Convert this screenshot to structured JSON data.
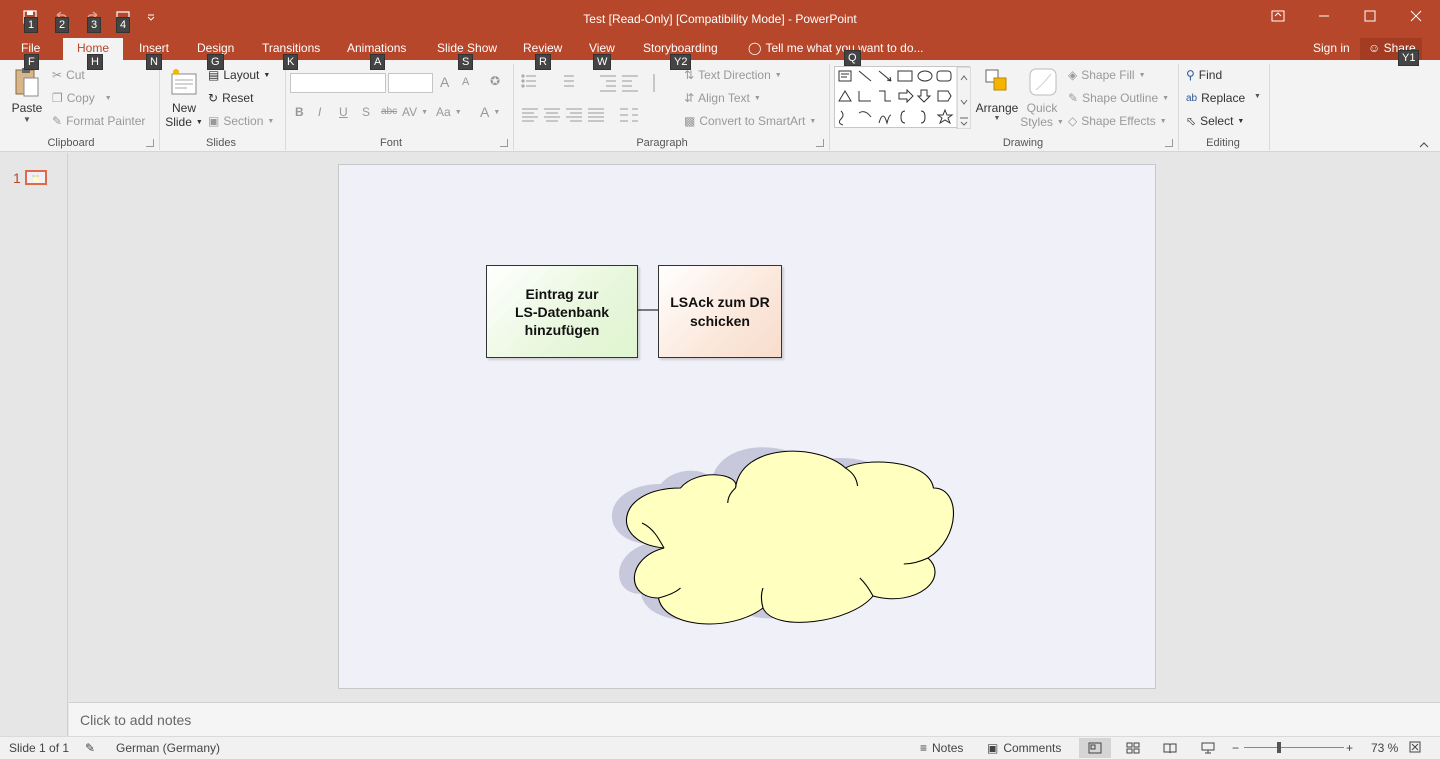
{
  "window": {
    "title": "Test [Read-Only] [Compatibility Mode] - PowerPoint",
    "sign_in": "Sign in",
    "share": "Share",
    "share_keytip": "Y1"
  },
  "qat_keytips": [
    "1",
    "2",
    "3",
    "4"
  ],
  "tabs": [
    {
      "label": "File",
      "keytip": "F"
    },
    {
      "label": "Home",
      "keytip": "H"
    },
    {
      "label": "Insert",
      "keytip": "N"
    },
    {
      "label": "Design",
      "keytip": "G"
    },
    {
      "label": "Transitions",
      "keytip": "K"
    },
    {
      "label": "Animations",
      "keytip": "A"
    },
    {
      "label": "Slide Show",
      "keytip": "S"
    },
    {
      "label": "Review",
      "keytip": "R"
    },
    {
      "label": "View",
      "keytip": "W"
    },
    {
      "label": "Storyboarding",
      "keytip": "Y2"
    }
  ],
  "tell_me": {
    "placeholder": "Tell me what you want to do...",
    "keytip": "Q"
  },
  "ribbon": {
    "clipboard": {
      "label": "Clipboard",
      "paste": "Paste",
      "cut": "Cut",
      "copy": "Copy",
      "format_painter": "Format Painter"
    },
    "slides": {
      "label": "Slides",
      "new_slide_1": "New",
      "new_slide_2": "Slide",
      "layout": "Layout",
      "reset": "Reset",
      "section": "Section"
    },
    "font": {
      "label": "Font",
      "bold": "B",
      "italic": "I",
      "underline": "U",
      "shadow": "S",
      "strike": "abc",
      "spacing": "AV",
      "case": "Aa",
      "grow": "A",
      "shrink": "A",
      "color": "A"
    },
    "paragraph": {
      "label": "Paragraph",
      "text_direction": "Text Direction",
      "align_text": "Align Text",
      "convert_smartart": "Convert to SmartArt"
    },
    "drawing": {
      "label": "Drawing",
      "arrange": "Arrange",
      "quick_styles_1": "Quick",
      "quick_styles_2": "Styles",
      "shape_fill": "Shape Fill",
      "shape_outline": "Shape Outline",
      "shape_effects": "Shape Effects"
    },
    "editing": {
      "label": "Editing",
      "find": "Find",
      "replace": "Replace",
      "select": "Select"
    }
  },
  "thumbnail": {
    "number": "1"
  },
  "slide": {
    "box1_lines": [
      "Eintrag zur",
      "LS-Datenbank",
      "hinzufügen"
    ],
    "box2_lines": [
      "LSAck zum DR",
      "schicken"
    ]
  },
  "notes_placeholder": "Click to add notes",
  "status": {
    "slide_of": "Slide 1 of 1",
    "language": "German (Germany)",
    "notes": "Notes",
    "comments": "Comments",
    "zoom": "73 %"
  },
  "colors": {
    "accent": "#b7472a",
    "box1_fill": "#dff5d0",
    "box2_fill": "#f8dccb",
    "cloud_fill": "#ffffc0"
  }
}
